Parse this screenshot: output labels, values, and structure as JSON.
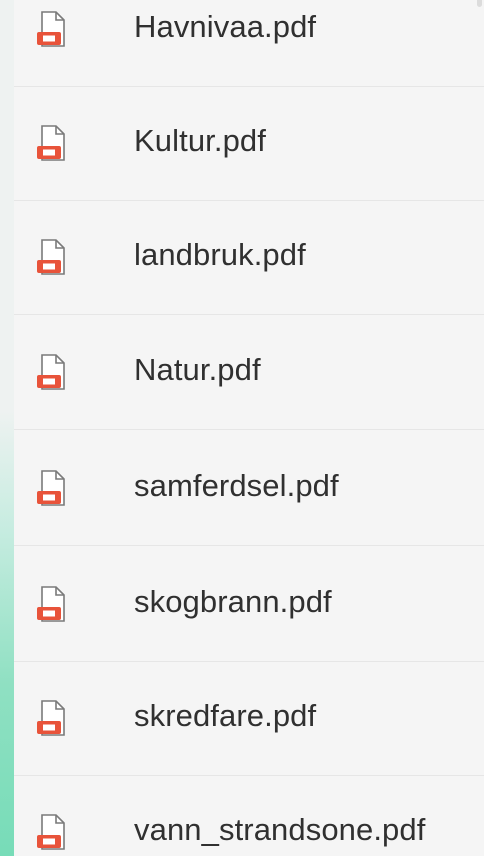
{
  "files": [
    {
      "name": "Havnivaa.pdf",
      "icon": "pdf-file-icon"
    },
    {
      "name": "Kultur.pdf",
      "icon": "pdf-file-icon"
    },
    {
      "name": "landbruk.pdf",
      "icon": "pdf-file-icon"
    },
    {
      "name": "Natur.pdf",
      "icon": "pdf-file-icon"
    },
    {
      "name": "samferdsel.pdf",
      "icon": "pdf-file-icon"
    },
    {
      "name": "skogbrann.pdf",
      "icon": "pdf-file-icon"
    },
    {
      "name": "skredfare.pdf",
      "icon": "pdf-file-icon"
    },
    {
      "name": "vann_strandsone.pdf",
      "icon": "pdf-file-icon"
    }
  ],
  "colors": {
    "list_background": "#f5f5f5",
    "pdf_accent": "#e8533a",
    "text": "#303030",
    "divider": "#e6e6e6"
  }
}
